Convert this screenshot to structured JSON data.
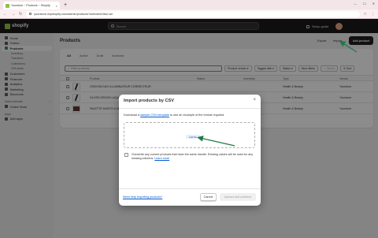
{
  "browser": {
    "tab_title": "Yourstore ~ Products ~ Shopify",
    "new_tab": "+",
    "close": "×",
    "url": "yourstore.myshopify.com/admin/products?selectedView=all",
    "win_min": "—",
    "win_max": "☐",
    "win_close": "✕",
    "back": "←",
    "forward": "→",
    "reload": "↻"
  },
  "topbar": {
    "logo": "shopify",
    "search_placeholder": "Search",
    "setup_guide": "Setup guide"
  },
  "sidebar": {
    "items": [
      {
        "label": "Home",
        "sub": false,
        "active": false
      },
      {
        "label": "Orders",
        "sub": false,
        "active": false
      },
      {
        "label": "Products",
        "sub": false,
        "active": true
      },
      {
        "label": "Inventory",
        "sub": true,
        "active": false
      },
      {
        "label": "Transfers",
        "sub": true,
        "active": false
      },
      {
        "label": "Collections",
        "sub": true,
        "active": false
      },
      {
        "label": "Gift cards",
        "sub": true,
        "active": false
      },
      {
        "label": "Customers",
        "sub": false,
        "active": false
      },
      {
        "label": "Finances",
        "sub": false,
        "active": false
      },
      {
        "label": "Analytics",
        "sub": false,
        "active": false
      },
      {
        "label": "Marketing",
        "sub": false,
        "active": false
      },
      {
        "label": "Discounts",
        "sub": false,
        "active": false
      }
    ],
    "sales_channels_label": "Sales channels",
    "online_store": "Online Store",
    "apps_label": "Apps",
    "add_apps": "Add apps"
  },
  "page": {
    "title": "Products",
    "export": "Export",
    "import": "Import",
    "add_product": "Add product"
  },
  "table": {
    "tabs": [
      "All",
      "Active",
      "Draft",
      "Archived"
    ],
    "filter_placeholder": "Filter products",
    "filters": [
      "Product vendor",
      "Tagged with",
      "Status",
      "More filters"
    ],
    "saved": "Saved",
    "sort": "Sort",
    "headers": {
      "product": "Product",
      "status": "Status",
      "inventory": "Inventory",
      "type": "Type",
      "vendor": "Vendor"
    },
    "rows": [
      {
        "product": "CRAYON DUO ILLUMINATEUR CORRECTEUR",
        "type": "Health & Beauty",
        "vendor": "Yourstore"
      },
      {
        "product": "GLOSS GROUS LAQUE",
        "type": "Health & Beauty",
        "vendor": "Yourstore"
      },
      {
        "product": "PALETTE MONTS & MERVEILLES",
        "type": "Health & Beauty",
        "vendor": "Yourstore"
      }
    ]
  },
  "modal": {
    "title": "Import products by CSV",
    "close": "×",
    "download_prefix": "Download a ",
    "download_link": "sample CSV template",
    "download_suffix": " to see an example of the format required.",
    "add_file": "Add file",
    "overwrite_text": "Overwrite any current products that have the same handle. Existing values will be used for any missing columns.",
    "learn_more": "Learn more",
    "help_link": "Need help importing products?",
    "cancel": "Cancel",
    "upload": "Upload and continue"
  },
  "colors": {
    "accent_green": "#1f7a45",
    "link_blue": "#005bd3"
  }
}
